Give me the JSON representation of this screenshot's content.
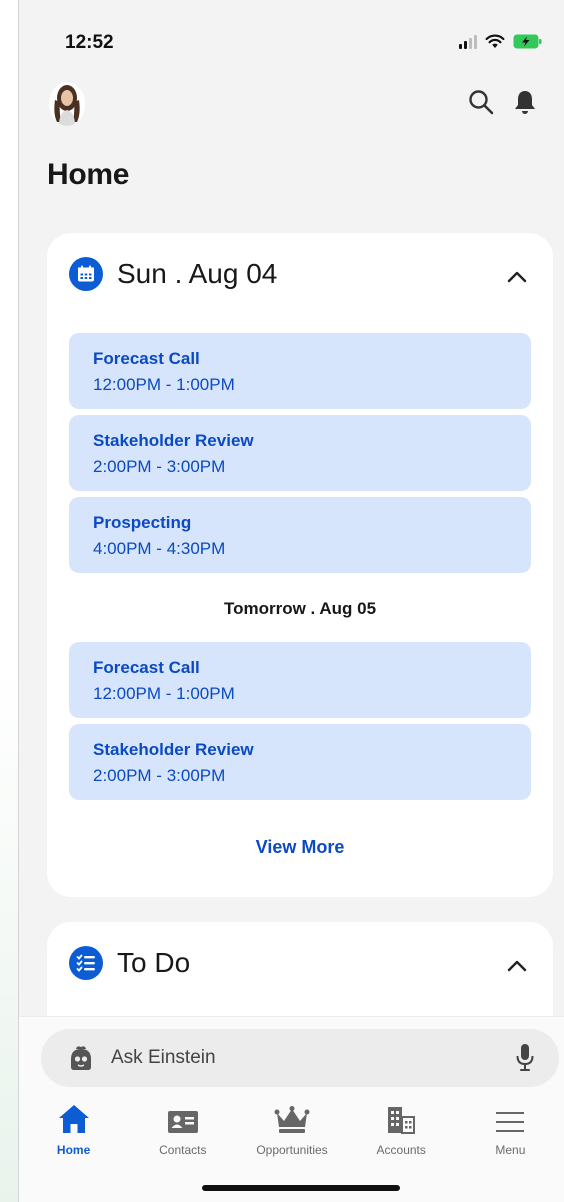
{
  "status_bar": {
    "time": "12:52"
  },
  "page": {
    "title": "Home"
  },
  "calendar": {
    "date_label": "Sun . Aug 04",
    "today_events": [
      {
        "name": "Forecast Call",
        "time": "12:00PM - 1:00PM"
      },
      {
        "name": "Stakeholder Review",
        "time": "2:00PM - 3:00PM"
      },
      {
        "name": "Prospecting",
        "time": "4:00PM - 4:30PM"
      }
    ],
    "next_day_label": "Tomorrow . Aug 05",
    "tomorrow_events": [
      {
        "name": "Forecast Call",
        "time": "12:00PM - 1:00PM"
      },
      {
        "name": "Stakeholder Review",
        "time": "2:00PM - 3:00PM"
      }
    ],
    "view_more_label": "View More"
  },
  "todo": {
    "title": "To Do"
  },
  "einstein": {
    "placeholder": "Ask Einstein"
  },
  "tabs": [
    {
      "label": "Home",
      "icon": "home-icon",
      "active": true
    },
    {
      "label": "Contacts",
      "icon": "contact-card-icon",
      "active": false
    },
    {
      "label": "Opportunities",
      "icon": "crown-icon",
      "active": false
    },
    {
      "label": "Accounts",
      "icon": "building-icon",
      "active": false
    },
    {
      "label": "Menu",
      "icon": "hamburger-menu-icon",
      "active": false
    }
  ],
  "colors": {
    "accent": "#0b5cd5",
    "event_bg": "#d6e5fb",
    "event_text": "#0b4ac2",
    "battery": "#34c759"
  }
}
